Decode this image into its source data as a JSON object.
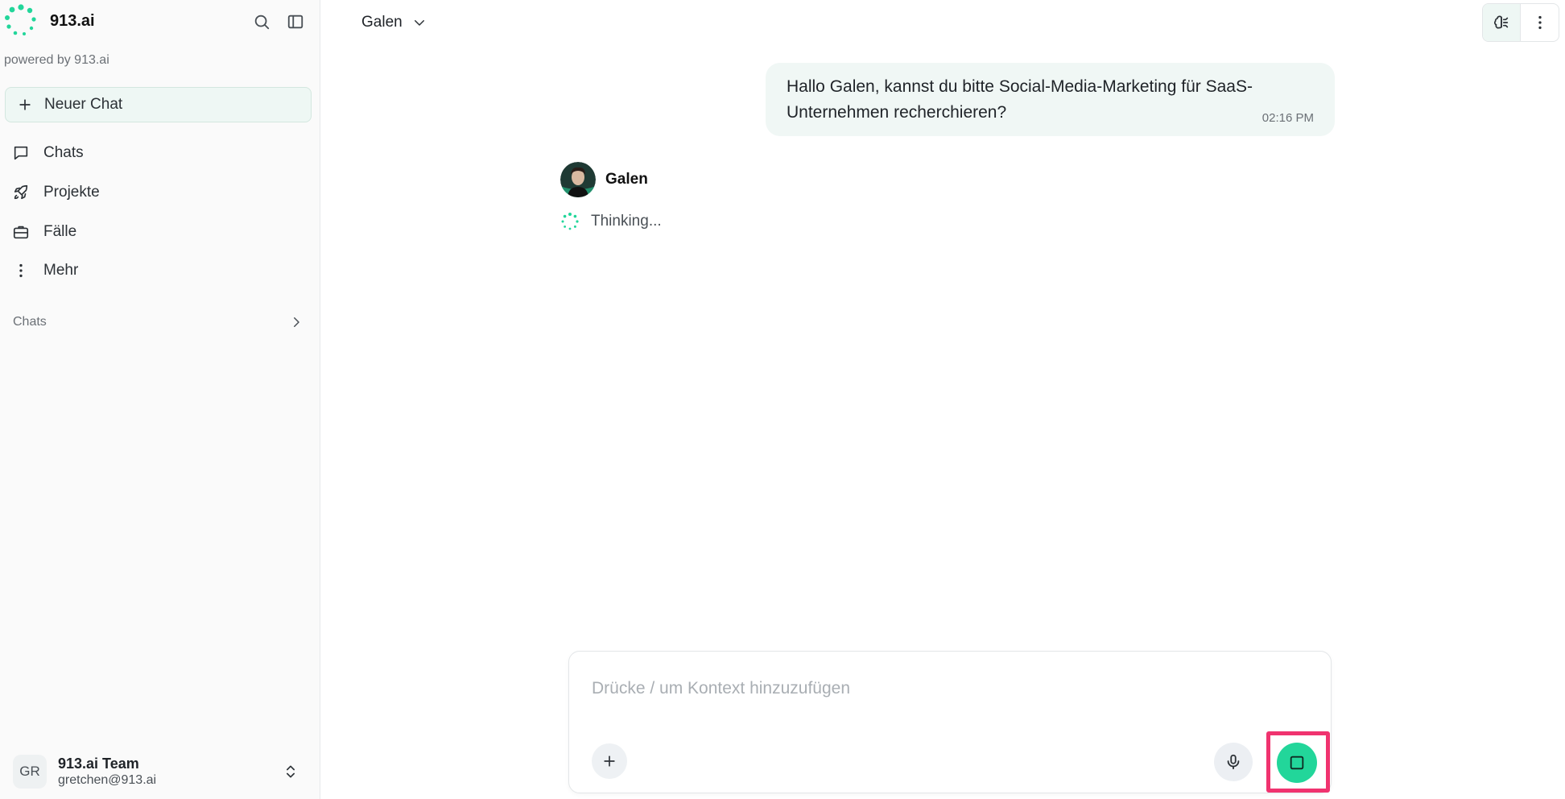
{
  "colors": {
    "accent": "#22d69a",
    "highlight": "#f0336f",
    "bubble_bg": "#f0f7f5"
  },
  "sidebar": {
    "brand": "913.ai",
    "powered_by": "powered by 913.ai",
    "new_chat_label": "Neuer Chat",
    "nav": {
      "chats": "Chats",
      "projects": "Projekte",
      "cases": "Fälle",
      "more": "Mehr"
    },
    "section_chats": "Chats",
    "user": {
      "initials": "GR",
      "name": "913.ai Team",
      "email": "gretchen@913.ai"
    }
  },
  "header": {
    "agent_name": "Galen"
  },
  "conversation": {
    "user_message": "Hallo Galen, kannst du bitte Social-Media-Marketing für SaaS-Unternehmen recherchieren?",
    "user_time": "02:16 PM",
    "agent_name": "Galen",
    "agent_status": "Thinking..."
  },
  "composer": {
    "placeholder": "Drücke / um Kontext hinzuzufügen",
    "value": ""
  },
  "icons": {
    "logo": "dotted-circle-logo-icon",
    "search": "search-icon",
    "panel": "sidebar-toggle-icon",
    "plus": "plus-icon",
    "chats": "chat-bubble-icon",
    "projects": "rocket-icon",
    "cases": "briefcase-icon",
    "more": "vertical-dots-icon",
    "chevron_right": "chevron-right-icon",
    "chevron_down": "chevron-down-icon",
    "updown": "chevron-up-down-icon",
    "brain": "brain-icon",
    "kebab": "kebab-menu-icon",
    "mic": "microphone-icon",
    "stop": "stop-square-icon",
    "spinner": "loading-spinner-icon"
  }
}
